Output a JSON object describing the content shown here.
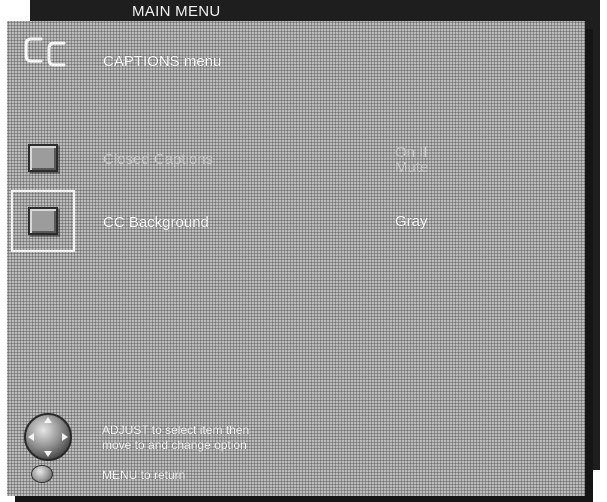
{
  "main_menu_title": "MAIN MENU",
  "captions_menu": {
    "logo_text": "CC",
    "title": "CAPTIONS menu",
    "items": [
      {
        "label": "Closed Captions",
        "value_line1": "On If",
        "value_line2": "Mute",
        "selected": false
      },
      {
        "label": "CC Background",
        "value_line1": "Gray",
        "selected": true
      }
    ]
  },
  "hints": {
    "adjust_line1": "ADJUST to select item then",
    "adjust_line2": "move to and change option",
    "menu": "MENU to return"
  },
  "icons": {
    "logo": "closed-captions-logo-icon",
    "item_box": "square-icon",
    "dial": "adjust-dial-icon",
    "menu": "menu-button-icon"
  },
  "colors": {
    "panel": "#a8a8a8",
    "back_panel": "#1e1e1e",
    "text_bright": "#fbfbfb",
    "text_dim": "#c6c6c6",
    "highlight_frame": "#f4f4f4"
  }
}
